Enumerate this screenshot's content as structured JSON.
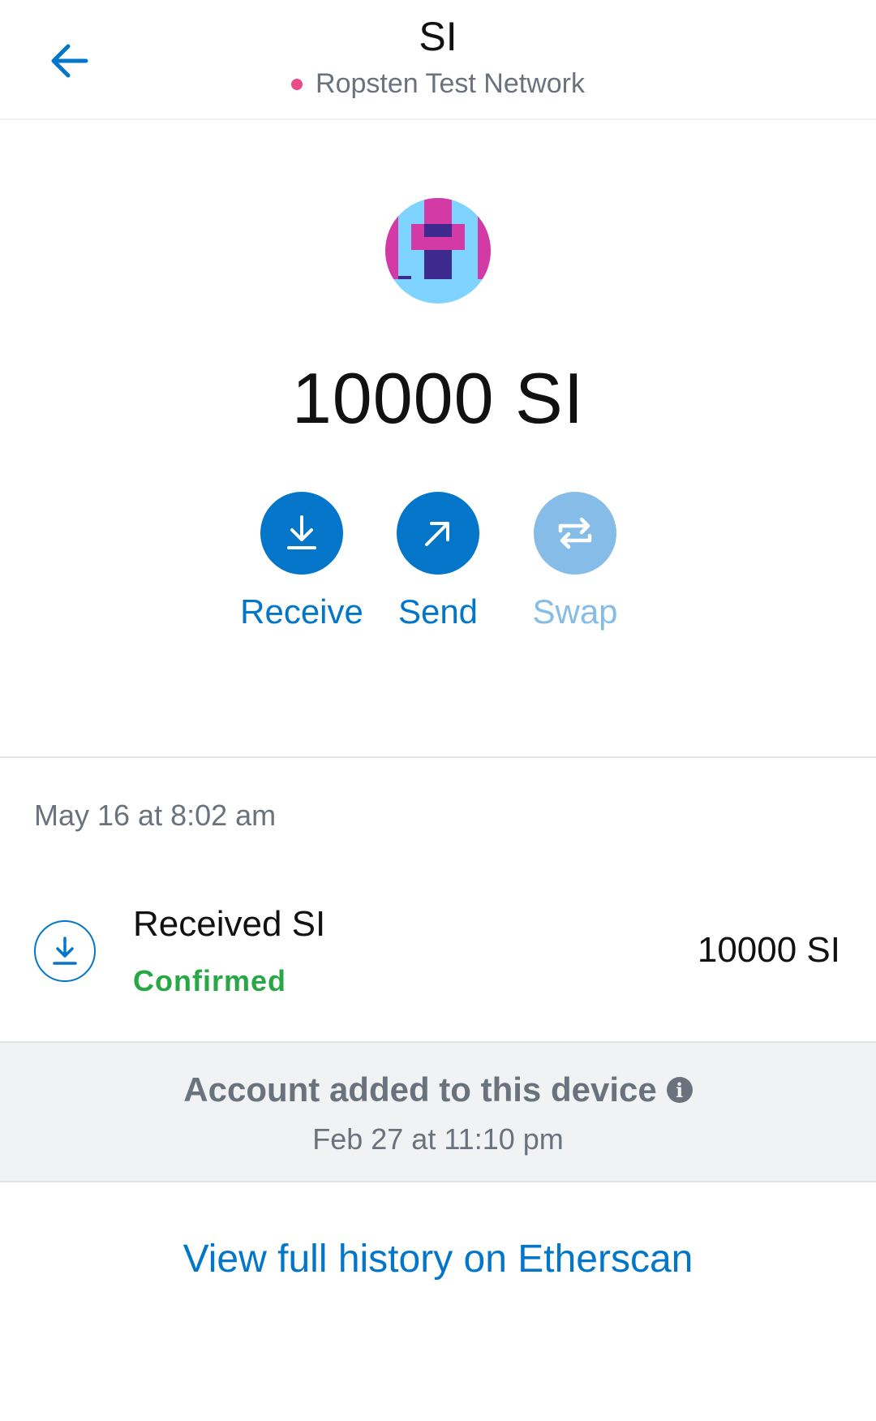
{
  "header": {
    "title": "SI",
    "network": "Ropsten Test Network",
    "network_dot_color": "#ea4c89",
    "back_icon": "arrow-left-icon"
  },
  "token": {
    "icon": "token-identicon",
    "balance": "10000 SI"
  },
  "actions": [
    {
      "label": "Receive",
      "icon": "download-arrow-icon",
      "enabled": true
    },
    {
      "label": "Send",
      "icon": "arrow-up-right-icon",
      "enabled": true
    },
    {
      "label": "Swap",
      "icon": "swap-arrows-icon",
      "enabled": false
    }
  ],
  "transactions": {
    "date": "May 16 at 8:02 am",
    "items": [
      {
        "title": "Received SI",
        "status": "Confirmed",
        "amount": "10000 SI",
        "icon": "receive-icon"
      }
    ]
  },
  "account_notice": {
    "title": "Account added to this device",
    "info_icon": "info-icon",
    "date": "Feb 27 at 11:10 pm"
  },
  "footer": {
    "etherscan_link": "View full history on Etherscan"
  },
  "colors": {
    "accent": "#0376c9",
    "accent_disabled": "#86bde8",
    "confirmed": "#28a745",
    "muted": "#6a737d"
  }
}
